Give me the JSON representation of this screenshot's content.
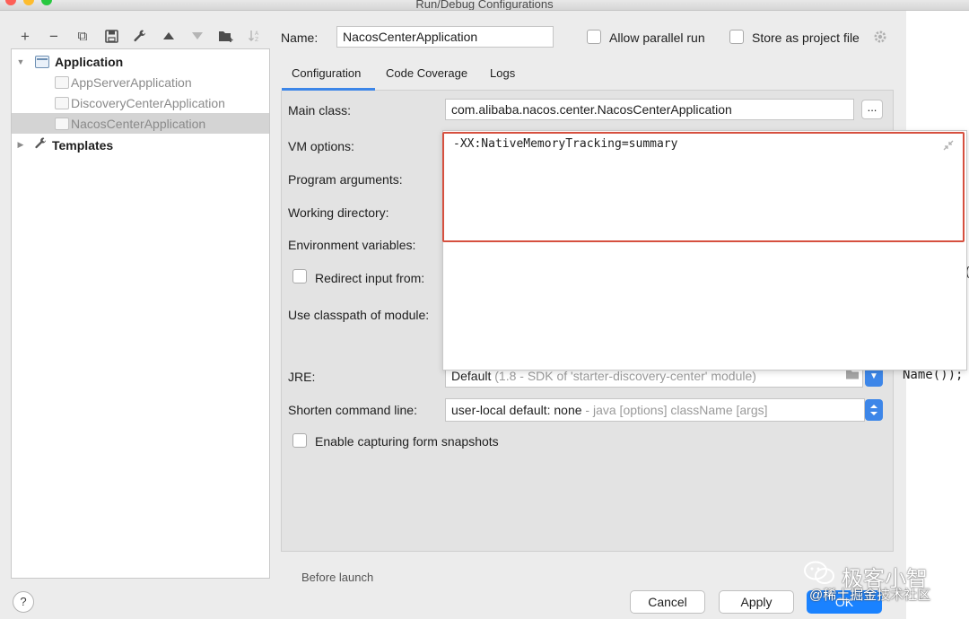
{
  "window": {
    "title": "Run/Debug Configurations"
  },
  "toolbar": {
    "add": "+",
    "remove": "−",
    "copy": "⧉",
    "save": "💾",
    "edit": "🔧",
    "up": "▲",
    "down": "▼",
    "folder": "📁",
    "sort": "⇅"
  },
  "tree": {
    "application": "Application",
    "children": [
      "AppServerApplication",
      "DiscoveryCenterApplication",
      "NacosCenterApplication"
    ],
    "templates": "Templates"
  },
  "header": {
    "name_label": "Name:",
    "name_value": "NacosCenterApplication",
    "allow_parallel": "Allow parallel run",
    "store_project": "Store as project file"
  },
  "tabs": [
    "Configuration",
    "Code Coverage",
    "Logs"
  ],
  "form": {
    "main_class_label": "Main class:",
    "main_class_value": "com.alibaba.nacos.center.NacosCenterApplication",
    "dots": "...",
    "vm_options_label": "VM options:",
    "program_args_label": "Program arguments:",
    "working_dir_label": "Working directory:",
    "env_vars_label": "Environment variables:",
    "redirect_label": "Redirect input from:",
    "classpath_label": "Use classpath of module:",
    "jre_label": "JRE:",
    "jre_value": "Default",
    "jre_detail": "(1.8 - SDK of 'starter-discovery-center' module)",
    "shorten_label": "Shorten command line:",
    "shorten_value": "user-local default: none",
    "shorten_detail": " - java [options] className [args]",
    "capture_label": "Enable capturing form snapshots"
  },
  "popup": {
    "vm_text": "-XX:NativeMemoryTracking=summary"
  },
  "code_snippet": "Name());",
  "paren_snippet": "(",
  "footer": {
    "help": "?",
    "cancel": "Cancel",
    "apply": "Apply",
    "ok": "OK",
    "hidden_row": "Before launch"
  },
  "watermark": {
    "main": "极客小智",
    "sub": "@稀土掘金技术社区"
  },
  "colors": {
    "accent": "#3d86e8",
    "highlight": "#d6503f",
    "primary_button": "#1a82ff"
  }
}
